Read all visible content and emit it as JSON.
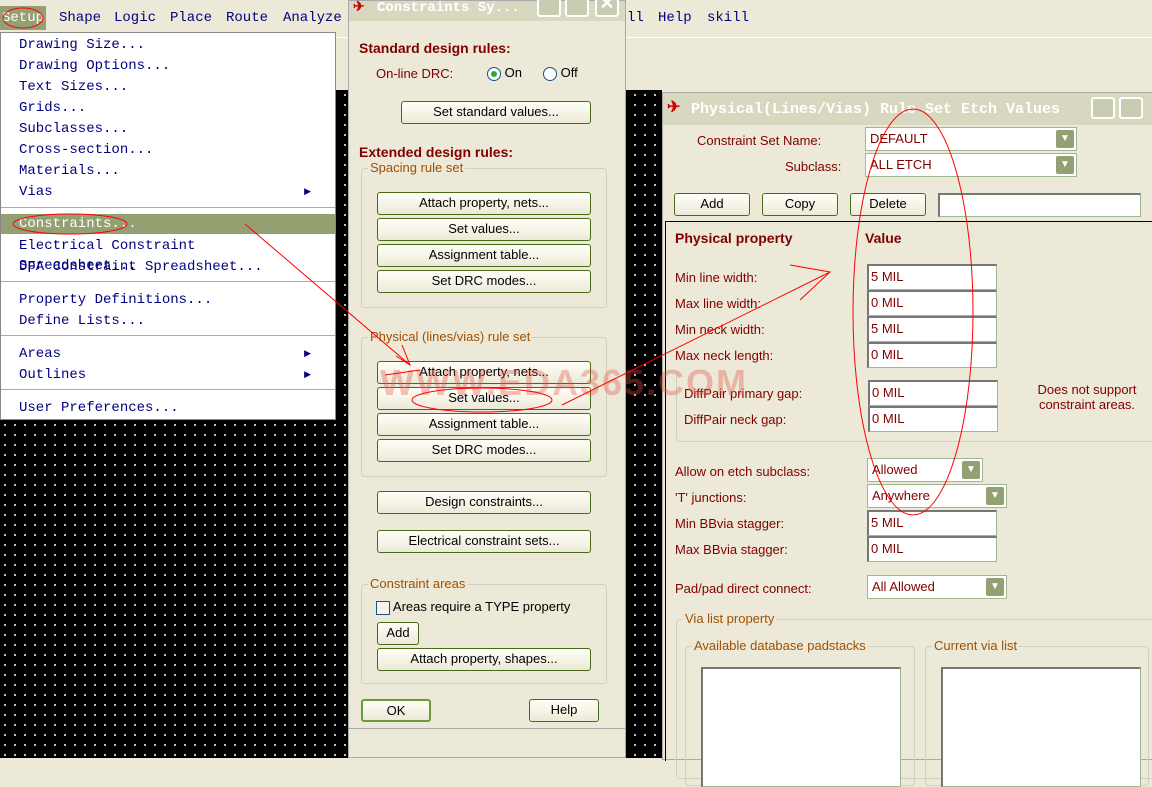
{
  "menubar": {
    "items": [
      "Setup",
      "Shape",
      "Logic",
      "Place",
      "Route",
      "Analyze",
      "ll",
      "Help",
      "skill"
    ]
  },
  "setup_menu": {
    "items": [
      "Drawing Size...",
      "Drawing Options...",
      "Text Sizes...",
      "Grids...",
      "Subclasses...",
      "Cross-section...",
      "Materials...",
      "Vias",
      "Constraints...",
      "Electrical Constraint Spreadsheet...",
      "DFA Constraint Spreadsheet...",
      "Property Definitions...",
      "Define Lists...",
      "Areas",
      "Outlines",
      "User Preferences..."
    ]
  },
  "constraints_dialog": {
    "title": "Constraints Sy...",
    "standard_heading": "Standard design rules:",
    "online_drc_label": "On-line DRC:",
    "on_label": "On",
    "off_label": "Off",
    "set_standard": "Set standard values...",
    "extended_heading": "Extended design rules:",
    "spacing_group": "Spacing rule set",
    "spacing_buttons": [
      "Attach property, nets...",
      "Set values...",
      "Assignment table...",
      "Set DRC modes..."
    ],
    "physical_group": "Physical (lines/vias) rule set",
    "physical_buttons": [
      "Attach property, nets...",
      "Set values...",
      "Assignment table...",
      "Set DRC modes..."
    ],
    "design_constraints": "Design constraints...",
    "electrical_sets": "Electrical constraint sets...",
    "areas_group": "Constraint areas",
    "areas_checkbox": "Areas require a TYPE property",
    "add": "Add",
    "attach_shapes": "Attach property, shapes...",
    "ok": "OK",
    "help": "Help"
  },
  "physical_dialog": {
    "title": "Physical(Lines/Vias) Rule Set Etch Values",
    "set_name_label": "Constraint Set Name:",
    "set_name": "DEFAULT",
    "subclass_label": "Subclass:",
    "subclass": "ALL ETCH",
    "add": "Add",
    "copy": "Copy",
    "delete": "Delete",
    "name_input": "",
    "col_property": "Physical property",
    "col_value": "Value",
    "props": [
      {
        "label": "Min line width:",
        "value": "5 MIL"
      },
      {
        "label": "Max line width:",
        "value": "0 MIL"
      },
      {
        "label": "Min neck width:",
        "value": "5 MIL"
      },
      {
        "label": "Max neck length:",
        "value": "0 MIL"
      }
    ],
    "diffpair": [
      {
        "label": "DiffPair primary gap:",
        "value": "0 MIL"
      },
      {
        "label": "DiffPair neck gap:",
        "value": "0 MIL"
      }
    ],
    "no_areas_note": "Does not support constraint areas.",
    "allow_label": "Allow on etch subclass:",
    "allow_value": "Allowed",
    "t_label": "'T' junctions:",
    "t_value": "Anywhere",
    "min_bb_label": "Min BBvia stagger:",
    "min_bb": "5 MIL",
    "max_bb_label": "Max BBvia stagger:",
    "max_bb": "0 MIL",
    "pad_label": "Pad/pad direct connect:",
    "pad_value": "All Allowed",
    "via_group": "Via list property",
    "available": "Available database padstacks",
    "current": "Current via list"
  },
  "watermark": "WWW.EDA365.COM",
  "colors": {
    "accent": "#94a073",
    "label": "#800000",
    "annotation": "#ff0000"
  }
}
